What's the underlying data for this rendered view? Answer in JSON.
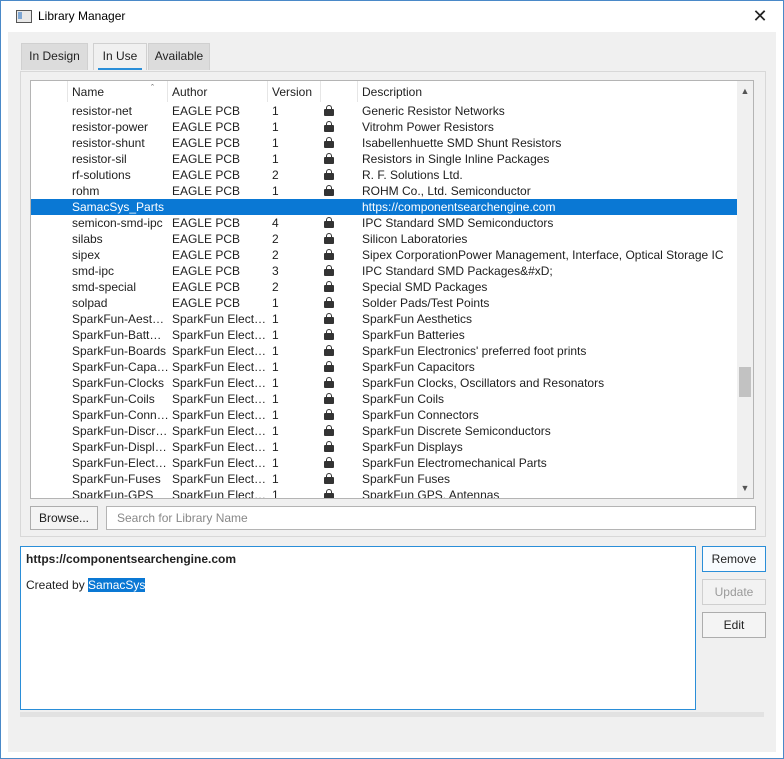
{
  "window": {
    "title": "Library Manager",
    "close": "✕"
  },
  "tabs": [
    {
      "label": "In Design"
    },
    {
      "label": "In Use"
    },
    {
      "label": "Available"
    }
  ],
  "table": {
    "columns": {
      "name": "Name",
      "author": "Author",
      "version": "Version",
      "icon": "",
      "description": "Description"
    },
    "sort_icon": "ˆ",
    "rows": [
      {
        "name": "resistor-net",
        "author": "EAGLE PCB",
        "version": "1",
        "icon": "lock-icon",
        "description": "Generic Resistor Networks"
      },
      {
        "name": "resistor-power",
        "author": "EAGLE PCB",
        "version": "1",
        "icon": "lock-icon",
        "description": "Vitrohm Power Resistors"
      },
      {
        "name": "resistor-shunt",
        "author": "EAGLE PCB",
        "version": "1",
        "icon": "lock-icon",
        "description": "Isabellenhuette SMD Shunt Resistors"
      },
      {
        "name": "resistor-sil",
        "author": "EAGLE PCB",
        "version": "1",
        "icon": "lock-icon",
        "description": "Resistors in Single Inline Packages"
      },
      {
        "name": "rf-solutions",
        "author": "EAGLE PCB",
        "version": "2",
        "icon": "lock-icon",
        "description": "R. F. Solutions Ltd."
      },
      {
        "name": "rohm",
        "author": "EAGLE PCB",
        "version": "1",
        "icon": "lock-icon",
        "description": "ROHM Co., Ltd. Semiconductor"
      },
      {
        "name": "SamacSys_Parts",
        "author": "",
        "version": "",
        "icon": "",
        "description": "https://componentsearchengine.com",
        "selected": true
      },
      {
        "name": "semicon-smd-ipc",
        "author": "EAGLE PCB",
        "version": "4",
        "icon": "lock-icon",
        "description": "IPC Standard SMD Semiconductors"
      },
      {
        "name": "silabs",
        "author": "EAGLE PCB",
        "version": "2",
        "icon": "lock-icon",
        "description": "Silicon Laboratories"
      },
      {
        "name": "sipex",
        "author": "EAGLE PCB",
        "version": "2",
        "icon": "lock-icon",
        "description": "Sipex CorporationPower Management, Interface, Optical Storage IC"
      },
      {
        "name": "smd-ipc",
        "author": "EAGLE PCB",
        "version": "3",
        "icon": "lock-icon",
        "description": "IPC Standard SMD Packages&#xD;"
      },
      {
        "name": "smd-special",
        "author": "EAGLE PCB",
        "version": "2",
        "icon": "lock-icon",
        "description": "Special SMD Packages"
      },
      {
        "name": "solpad",
        "author": "EAGLE PCB",
        "version": "1",
        "icon": "lock-icon",
        "description": "Solder Pads/Test Points"
      },
      {
        "name": "SparkFun-Aest…",
        "author": "SparkFun Elect…",
        "version": "1",
        "icon": "lock-icon",
        "description": "SparkFun Aesthetics"
      },
      {
        "name": "SparkFun-Batt…",
        "author": "SparkFun Elect…",
        "version": "1",
        "icon": "lock-icon",
        "description": "SparkFun Batteries"
      },
      {
        "name": "SparkFun-Boards",
        "author": "SparkFun Elect…",
        "version": "1",
        "icon": "lock-icon",
        "description": "SparkFun Electronics' preferred foot prints"
      },
      {
        "name": "SparkFun-Capa…",
        "author": "SparkFun Elect…",
        "version": "1",
        "icon": "lock-icon",
        "description": "SparkFun Capacitors"
      },
      {
        "name": "SparkFun-Clocks",
        "author": "SparkFun Elect…",
        "version": "1",
        "icon": "lock-icon",
        "description": "SparkFun Clocks, Oscillators and Resonators"
      },
      {
        "name": "SparkFun-Coils",
        "author": "SparkFun Elect…",
        "version": "1",
        "icon": "lock-icon",
        "description": "SparkFun Coils"
      },
      {
        "name": "SparkFun-Conn…",
        "author": "SparkFun Elect…",
        "version": "1",
        "icon": "lock-icon",
        "description": "SparkFun Connectors"
      },
      {
        "name": "SparkFun-Discr…",
        "author": "SparkFun Elect…",
        "version": "1",
        "icon": "lock-icon",
        "description": "SparkFun Discrete Semiconductors"
      },
      {
        "name": "SparkFun-Displ…",
        "author": "SparkFun Elect…",
        "version": "1",
        "icon": "lock-icon",
        "description": "SparkFun Displays"
      },
      {
        "name": "SparkFun-Elect…",
        "author": "SparkFun Elect…",
        "version": "1",
        "icon": "lock-icon",
        "description": "SparkFun Electromechanical Parts"
      },
      {
        "name": "SparkFun-Fuses",
        "author": "SparkFun Elect…",
        "version": "1",
        "icon": "lock-icon",
        "description": "SparkFun Fuses"
      },
      {
        "name": "SparkFun-GPS",
        "author": "SparkFun Elect…",
        "version": "1",
        "icon": "lock-icon",
        "description": "SparkFun GPS, Antennas"
      }
    ]
  },
  "browse_label": "Browse...",
  "search": {
    "placeholder": "Search for Library Name",
    "value": ""
  },
  "details": {
    "title": "https://componentsearchengine.com",
    "created_prefix": "Created by ",
    "created_by": "SamacSys"
  },
  "buttons": {
    "remove": "Remove",
    "update": "Update",
    "edit": "Edit"
  },
  "colors": {
    "accent": "#2a8ed8",
    "selection": "#0a78d4",
    "disabled_text": "#9a9a9a"
  }
}
